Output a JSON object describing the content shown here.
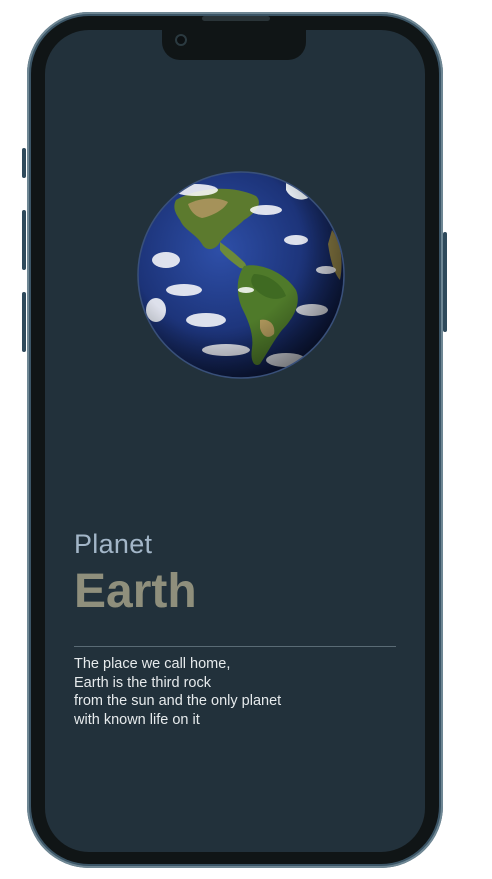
{
  "app": {
    "name": "Planet Earth info card"
  },
  "hero": {
    "image_icon": "earth-globe-image"
  },
  "content": {
    "kicker": "Planet",
    "title": "Earth",
    "description_lines": [
      "The place we call home,",
      "Earth is the third rock",
      "from the sun and the only planet",
      "with known life on it"
    ]
  },
  "colors": {
    "screen_background": "#22313b",
    "kicker": "#a3b6c8",
    "title": "#8f8f7c",
    "body_text": "#e6eaec",
    "frame": "#3b5566"
  }
}
